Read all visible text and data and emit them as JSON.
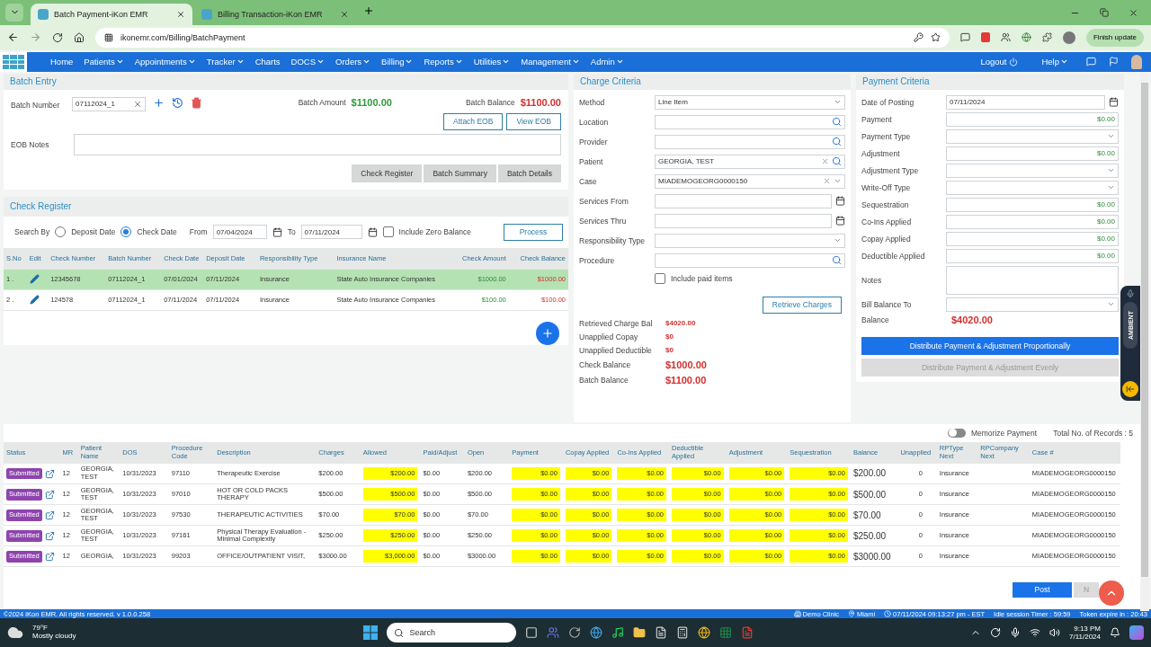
{
  "browser": {
    "tabs": [
      {
        "title": "Batch Payment-iKon EMR",
        "selected": true
      },
      {
        "title": "Billing Transaction-iKon EMR",
        "selected": false
      }
    ],
    "url": "ikonemr.com/Billing/BatchPayment",
    "update_button": "Finish update"
  },
  "nav": {
    "items": [
      {
        "label": "Home",
        "dropdown": false
      },
      {
        "label": "Patients",
        "dropdown": true
      },
      {
        "label": "Appointments",
        "dropdown": true
      },
      {
        "label": "Tracker",
        "dropdown": true
      },
      {
        "label": "Charts",
        "dropdown": false
      },
      {
        "label": "DOCS",
        "dropdown": true
      },
      {
        "label": "Orders",
        "dropdown": true
      },
      {
        "label": "Billing",
        "dropdown": true
      },
      {
        "label": "Reports",
        "dropdown": true
      },
      {
        "label": "Utilities",
        "dropdown": true
      },
      {
        "label": "Management",
        "dropdown": true
      },
      {
        "label": "Admin",
        "dropdown": true
      }
    ],
    "logout": "Logout",
    "help": "Help"
  },
  "batch_entry": {
    "title": "Batch Entry",
    "batch_number": {
      "label": "Batch Number",
      "value": "07112024_1"
    },
    "batch_amount": {
      "label": "Batch Amount",
      "value": "$1100.00"
    },
    "batch_balance": {
      "label": "Batch Balance",
      "value": "$1100.00"
    },
    "eob_buttons": [
      "Attach EOB",
      "View EOB"
    ],
    "eob_notes": {
      "label": "EOB Notes"
    },
    "view_buttons": [
      "Check Register",
      "Batch Summary",
      "Batch Details"
    ]
  },
  "check_register": {
    "title": "Check Register",
    "search_by": "Search By",
    "radios": [
      {
        "label": "Deposit Date",
        "selected": false
      },
      {
        "label": "Check Date",
        "selected": true
      }
    ],
    "from": {
      "label": "From",
      "value": "07/04/2024"
    },
    "to": {
      "label": "To",
      "value": "07/11/2024"
    },
    "include_zero": {
      "label": "Include Zero Balance",
      "checked": false
    },
    "process": "Process",
    "columns": [
      "S.No",
      "Edit",
      "Check Number",
      "Batch Number",
      "Check Date",
      "Deposit Date",
      "Responsibility Type",
      "Insurance Name",
      "Check Amount",
      "Check Balance"
    ],
    "rows": [
      {
        "sno": "1 .",
        "check_number": "12345678",
        "batch_number": "07112024_1",
        "check_date": "07/01/2024",
        "deposit_date": "07/11/2024",
        "responsibility_type": "Insurance",
        "insurance_name": "State Auto Insurance Companies",
        "check_amount": "$1000.00",
        "check_balance": "$1000.00",
        "selected": true
      },
      {
        "sno": "2 .",
        "check_number": "124578",
        "batch_number": "07112024_1",
        "check_date": "07/11/2024",
        "deposit_date": "07/11/2024",
        "responsibility_type": "Insurance",
        "insurance_name": "State Auto Insurance Companies",
        "check_amount": "$100.00",
        "check_balance": "$100.00",
        "selected": false
      }
    ]
  },
  "charge_criteria": {
    "title": "Charge Criteria",
    "fields": [
      {
        "label": "Method",
        "kind": "select",
        "value": "Line Item",
        "clearable": false
      },
      {
        "label": "Location",
        "kind": "search",
        "clearable": false
      },
      {
        "label": "Provider",
        "kind": "search",
        "clearable": false
      },
      {
        "label": "Patient",
        "kind": "search",
        "value": "GEORGIA, TEST",
        "clearable": true
      },
      {
        "label": "Case",
        "kind": "select",
        "value": "MIADEMOGEORG0000150",
        "clearable": true
      },
      {
        "label": "Services From",
        "kind": "date"
      },
      {
        "label": "Services Thru",
        "kind": "date"
      },
      {
        "label": "Responsibility Type",
        "kind": "select",
        "clearable": false
      },
      {
        "label": "Procedure",
        "kind": "search",
        "clearable": false
      }
    ],
    "include_paid": {
      "label": "Include paid items",
      "checked": false
    },
    "retrieve": "Retrieve Charges",
    "summary": [
      {
        "label": "Retrieved Charge Bal",
        "value": "$4020.00",
        "kind": "small"
      },
      {
        "label": "Unapplied Copay",
        "value": "$0",
        "kind": "small"
      },
      {
        "label": "Unapplied Deductible",
        "value": "$0",
        "kind": "small"
      },
      {
        "label": "Check Balance",
        "value": "$1000.00",
        "kind": "large"
      },
      {
        "label": "Batch Balance",
        "value": "$1100.00",
        "kind": "large"
      }
    ]
  },
  "payment_criteria": {
    "title": "Payment Criteria",
    "fields": [
      {
        "label": "Date of Posting",
        "kind": "date",
        "value": "07/11/2024"
      },
      {
        "label": "Payment",
        "kind": "money",
        "value": "$0.00"
      },
      {
        "label": "Payment Type",
        "kind": "select"
      },
      {
        "label": "Adjustment",
        "kind": "money",
        "value": "$0.00"
      },
      {
        "label": "Adjustment Type",
        "kind": "select"
      },
      {
        "label": "Write-Off Type",
        "kind": "select"
      },
      {
        "label": "Sequestration",
        "kind": "money",
        "value": "$0.00"
      },
      {
        "label": "Co-Ins Applied",
        "kind": "money",
        "value": "$0.00"
      },
      {
        "label": "Copay Applied",
        "kind": "money",
        "value": "$0.00"
      },
      {
        "label": "Deductible Applied",
        "kind": "money",
        "value": "$0.00"
      },
      {
        "label": "Notes",
        "kind": "textarea"
      },
      {
        "label": "Bill Balance To",
        "kind": "select"
      }
    ],
    "balance": {
      "label": "Balance",
      "value": "$4020.00"
    },
    "buttons": [
      {
        "label": "Distribute Payment & Adjustment Proportionally",
        "disabled": false
      },
      {
        "label": "Distribute Payment & Adjustment Evenly",
        "disabled": true
      }
    ]
  },
  "ambient": {
    "label": "AMBIENT"
  },
  "grid": {
    "memorize": {
      "label": "Memorize Payment",
      "on": false
    },
    "total": "Total No. of Records : 5",
    "columns": [
      "Status",
      "MR",
      "Patient Name",
      "DOS",
      "Procedure Code",
      "Description",
      "Charges",
      "Allowed",
      "Paid/Adjust",
      "Open",
      "Payment",
      "Copay Applied",
      "Co-Ins Applied",
      "Deductible Applied",
      "Adjustment",
      "Sequestration",
      "Balance",
      "Unapplied",
      "RPType Next",
      "RPCompany Next",
      "Case #"
    ],
    "rows": [
      {
        "status": "Submitted",
        "mr": "12",
        "patient": "GEORGIA, TEST",
        "dos": "10/31/2023",
        "code": "97110",
        "description": "Therapeutic Exercise",
        "charges": "$200.00",
        "allowed": "$200.00",
        "paid_adjust": "$0.00",
        "open": "$200.00",
        "payment": "$0.00",
        "copay": "$0.00",
        "coins": "$0.00",
        "deductible": "$0.00",
        "adjustment": "$0.00",
        "sequestration": "$0.00",
        "balance": "$200.00",
        "unapplied": "0",
        "rptype": "Insurance",
        "case": "MIADEMOGEORG0000150"
      },
      {
        "status": "Submitted",
        "mr": "12",
        "patient": "GEORGIA, TEST",
        "dos": "10/31/2023",
        "code": "97010",
        "description": "HOT OR COLD PACKS THERAPY",
        "charges": "$500.00",
        "allowed": "$500.00",
        "paid_adjust": "$0.00",
        "open": "$500.00",
        "payment": "$0.00",
        "copay": "$0.00",
        "coins": "$0.00",
        "deductible": "$0.00",
        "adjustment": "$0.00",
        "sequestration": "$0.00",
        "balance": "$500.00",
        "unapplied": "0",
        "rptype": "Insurance",
        "case": "MIADEMOGEORG0000150"
      },
      {
        "status": "Submitted",
        "mr": "12",
        "patient": "GEORGIA, TEST",
        "dos": "10/31/2023",
        "code": "97530",
        "description": "THERAPEUTIC ACTIVITIES",
        "charges": "$70.00",
        "allowed": "$70.00",
        "paid_adjust": "$0.00",
        "open": "$70.00",
        "payment": "$0.00",
        "copay": "$0.00",
        "coins": "$0.00",
        "deductible": "$0.00",
        "adjustment": "$0.00",
        "sequestration": "$0.00",
        "balance": "$70.00",
        "unapplied": "0",
        "rptype": "Insurance",
        "case": "MIADEMOGEORG0000150"
      },
      {
        "status": "Submitted",
        "mr": "12",
        "patient": "GEORGIA, TEST",
        "dos": "10/31/2023",
        "code": "97161",
        "description": "Physical Therapy Evaluation - Minimal Complexity",
        "charges": "$250.00",
        "allowed": "$250.00",
        "paid_adjust": "$0.00",
        "open": "$250.00",
        "payment": "$0.00",
        "copay": "$0.00",
        "coins": "$0.00",
        "deductible": "$0.00",
        "adjustment": "$0.00",
        "sequestration": "$0.00",
        "balance": "$250.00",
        "unapplied": "0",
        "rptype": "Insurance",
        "case": "MIADEMOGEORG0000150"
      },
      {
        "status": "Submitted",
        "mr": "12",
        "patient": "GEORGIA,",
        "dos": "10/31/2023",
        "code": "99203",
        "description": "OFFICE/OUTPATIENT VISIT,",
        "charges": "$3000.00",
        "allowed": "$3,000.00",
        "paid_adjust": "$0.00",
        "open": "$3000.00",
        "payment": "$0.00",
        "copay": "$0.00",
        "coins": "$0.00",
        "deductible": "$0.00",
        "adjustment": "$0.00",
        "sequestration": "$0.00",
        "balance": "$3000.00",
        "unapplied": "0",
        "rptype": "Insurance",
        "case": "MIADEMOGEORG0000150"
      }
    ],
    "actions": [
      "Post",
      "N"
    ]
  },
  "footer": {
    "copyright": "©2024 iKon EMR. All rights reserved. v 1.0.0.258",
    "clinic": "Demo Clinic",
    "location": "Miami",
    "datetime": "07/11/2024 09:13:27 pm - EST",
    "idle": "Idle session Timer : 59:59",
    "token": "Token expire in : 20:43"
  },
  "taskbar": {
    "temperature": "79°F",
    "weather": "Mostly cloudy",
    "search": "Search",
    "time": "9:13 PM",
    "date": "7/11/2024"
  }
}
